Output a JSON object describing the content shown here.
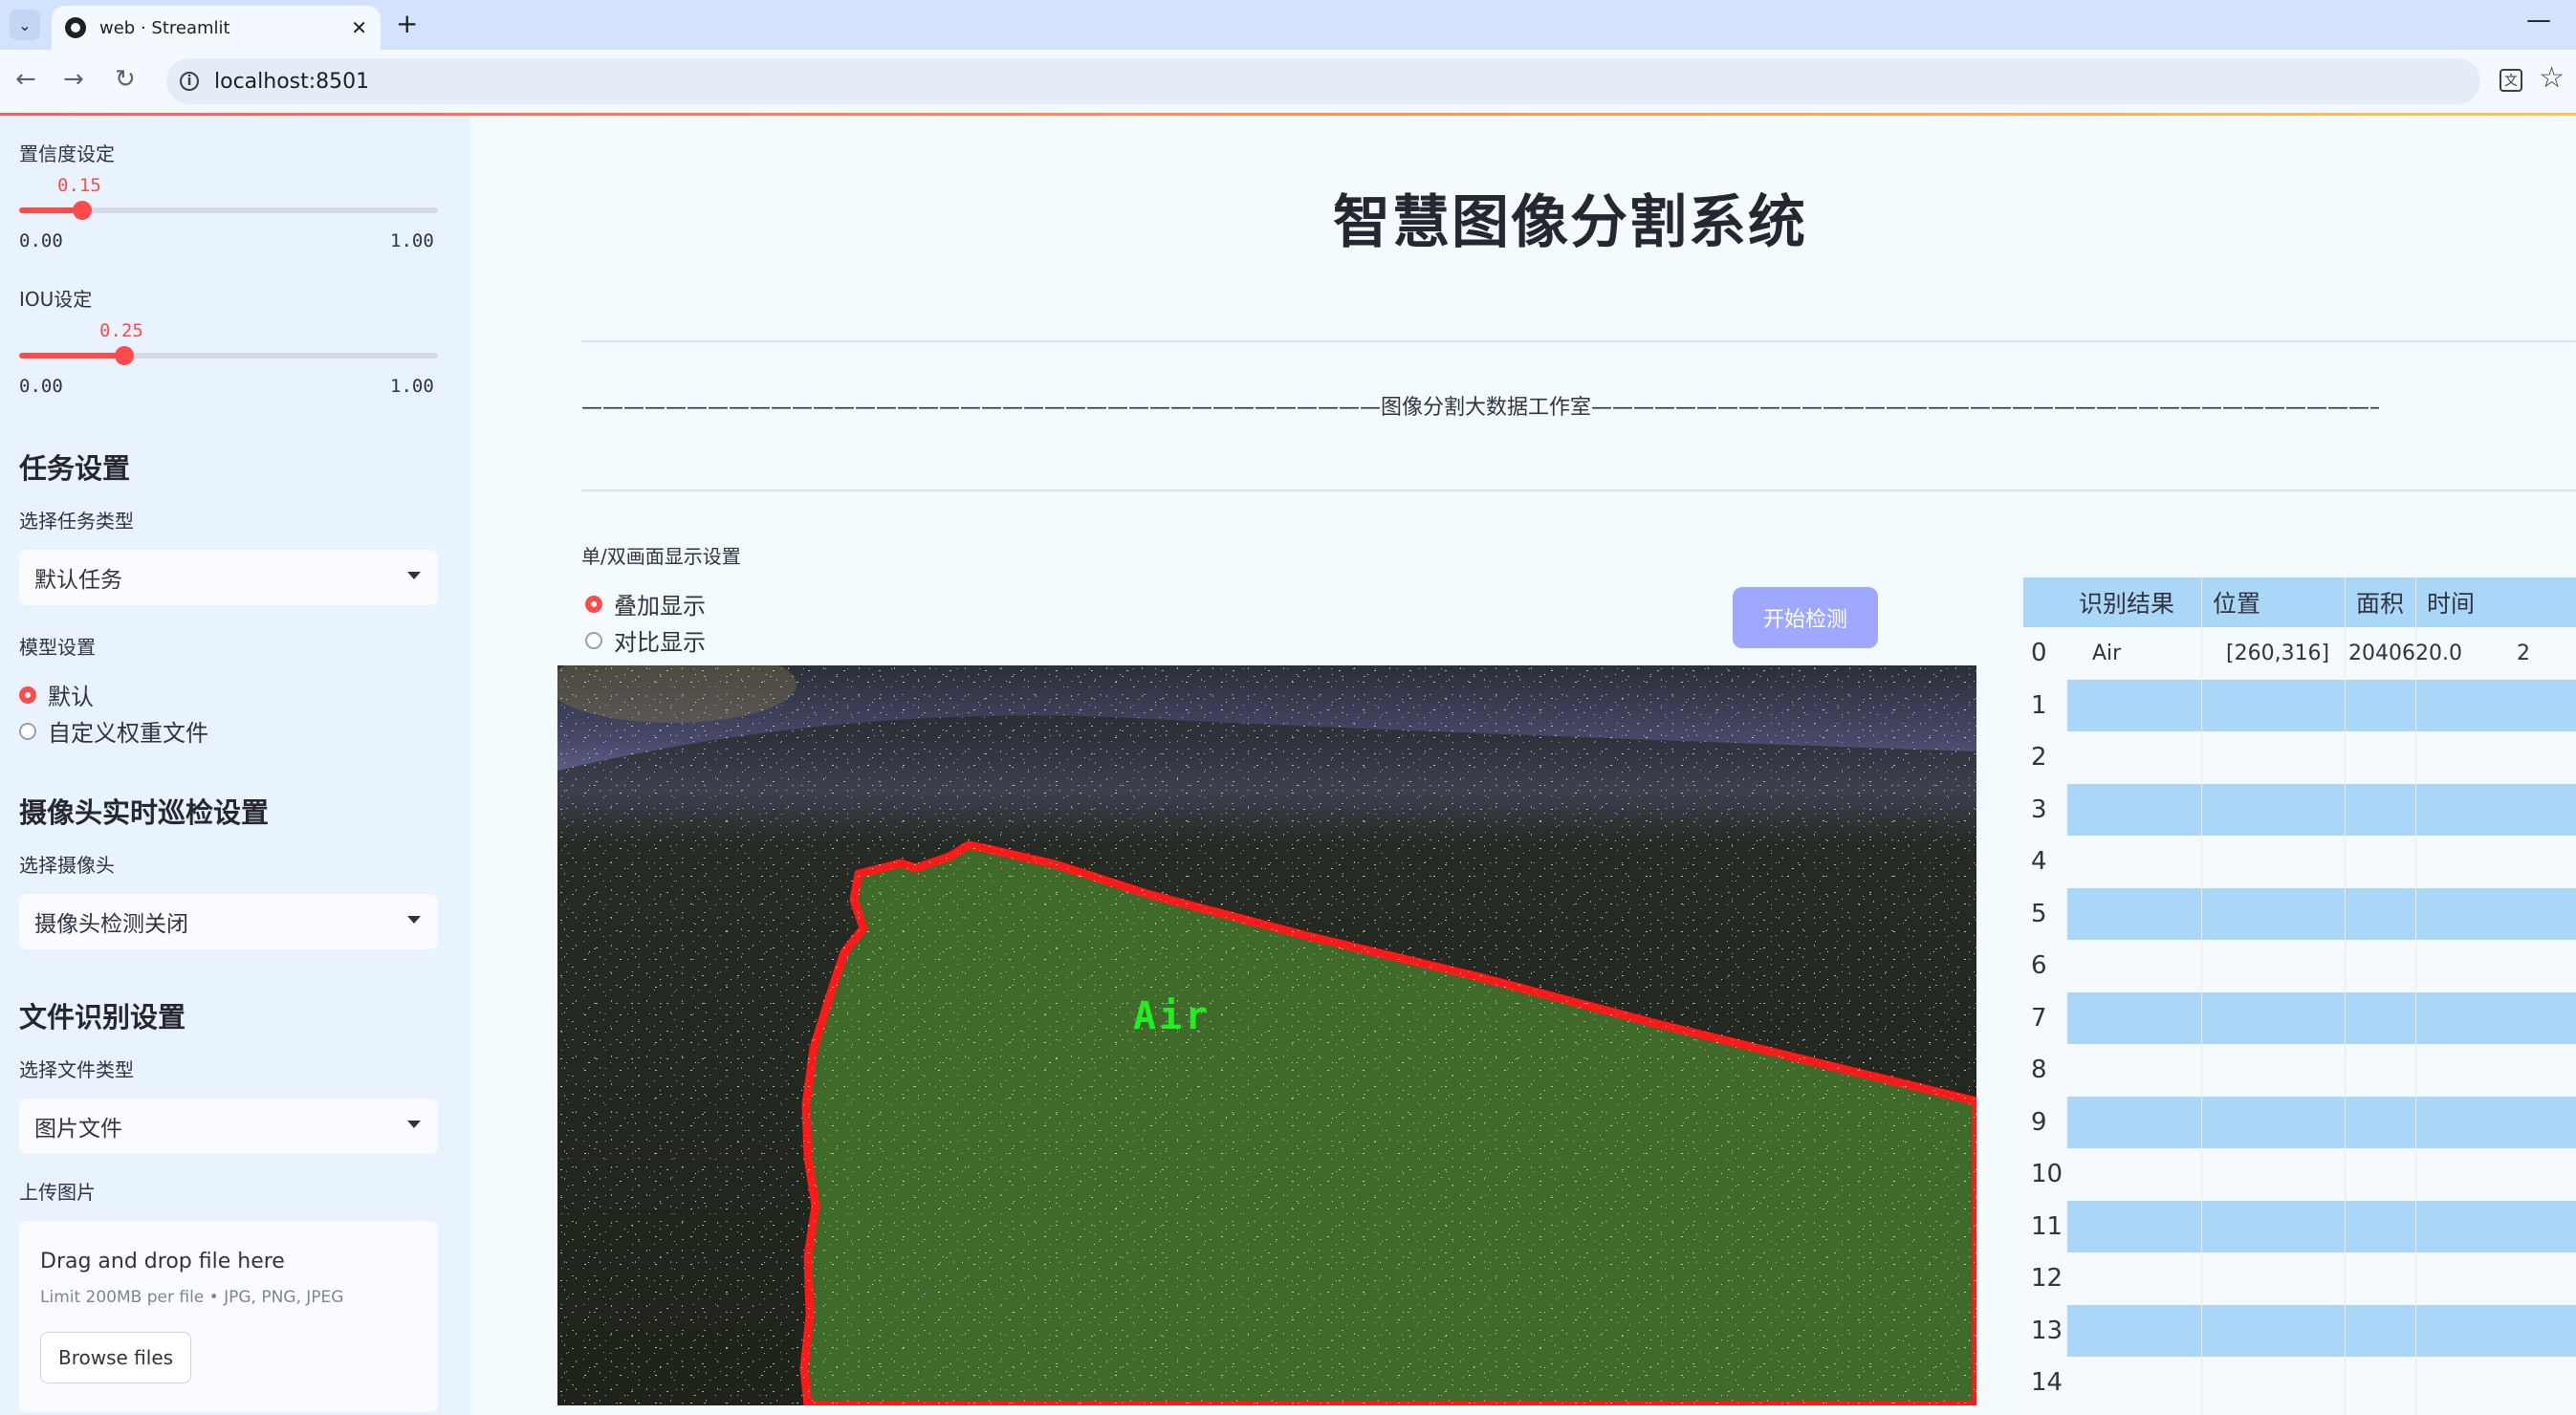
{
  "browser": {
    "tab_title": "web · Streamlit",
    "url": "localhost:8501"
  },
  "sidebar": {
    "confidence": {
      "label": "置信度设定",
      "value": "0.15",
      "min": "0.00",
      "max": "1.00",
      "fraction": 0.15
    },
    "iou": {
      "label": "IOU设定",
      "value": "0.25",
      "min": "0.00",
      "max": "1.00",
      "fraction": 0.25
    },
    "task_heading": "任务设置",
    "task_type_label": "选择任务类型",
    "task_type_value": "默认任务",
    "model_label": "模型设置",
    "model_options": [
      "默认",
      "自定义权重文件"
    ],
    "model_selected": 0,
    "camera_heading": "摄像头实时巡检设置",
    "camera_label": "选择摄像头",
    "camera_value": "摄像头检测关闭",
    "file_heading": "文件识别设置",
    "file_type_label": "选择文件类型",
    "file_type_value": "图片文件",
    "upload_label": "上传图片",
    "upload_title": "Drag and drop file here",
    "upload_limit": "Limit 200MB per file • JPG, PNG, JPEG",
    "browse_label": "Browse files"
  },
  "main": {
    "title": "智慧图像分割系统",
    "divider": "——————————————————————————————————————图像分割大数据工作室——————————————————————————————————————————",
    "display_label": "单/双画面显示设置",
    "display_options": [
      "叠加显示",
      "对比显示"
    ],
    "display_selected": 0,
    "start_button": "开始检测",
    "image_label": "Air"
  },
  "results_table": {
    "columns": [
      "识别结果",
      "位置",
      "面积",
      "时间"
    ],
    "row_indices": [
      "0",
      "1",
      "2",
      "3",
      "4",
      "5",
      "6",
      "7",
      "8",
      "9",
      "10",
      "11",
      "12",
      "13",
      "14"
    ],
    "rows": [
      {
        "result": "Air",
        "position": "[260,316]",
        "area": "2040620.0",
        "time": "2"
      }
    ]
  },
  "colors": {
    "accent": "#ff4b4b",
    "button": "#9fa8ff",
    "table_header": "#aad6f7",
    "sidebar_bg": "#e9f3fd",
    "mask_outline": "#ff1a1a",
    "mask_fill": "#3f6a2a"
  }
}
